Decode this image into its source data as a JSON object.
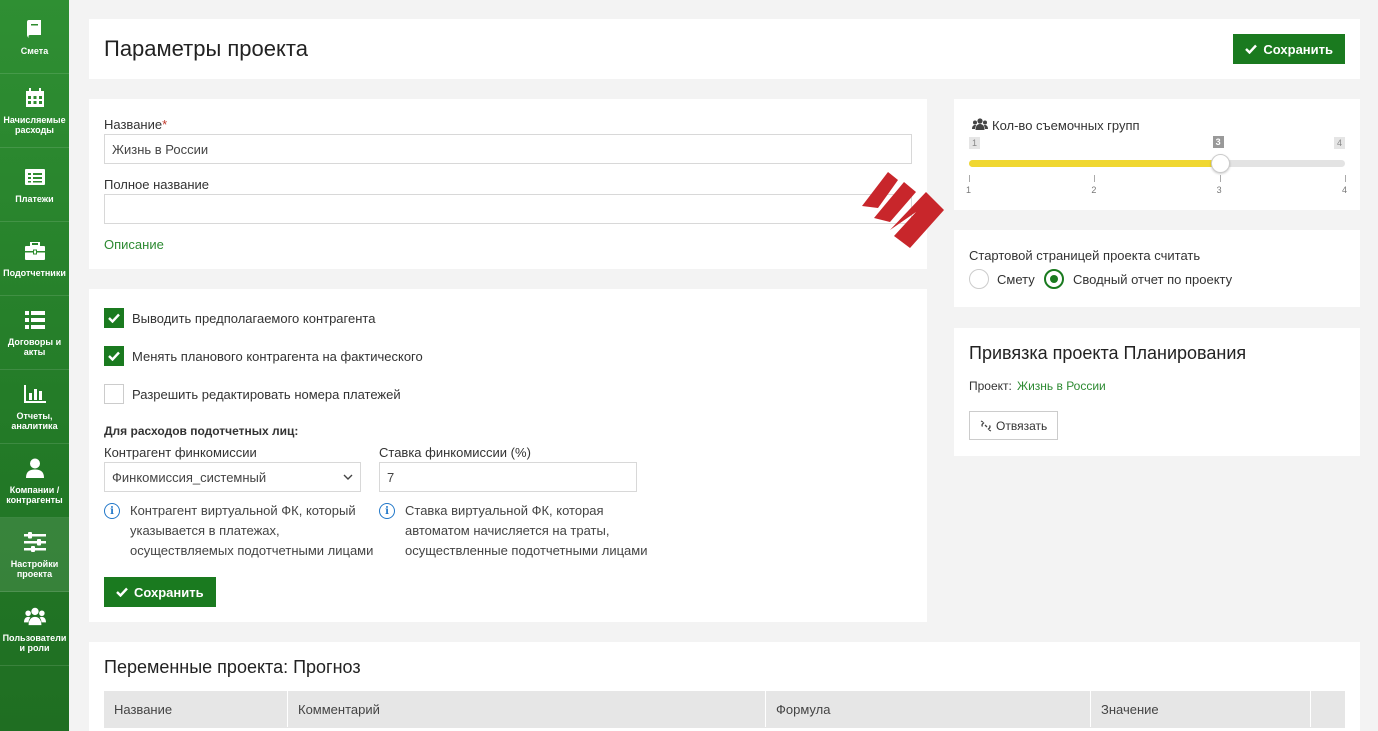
{
  "sidebar": {
    "items": [
      {
        "label": "Смета",
        "icon": "book-icon"
      },
      {
        "label": "Начисляемые расходы",
        "icon": "calendar-icon"
      },
      {
        "label": "Платежи",
        "icon": "list-icon"
      },
      {
        "label": "Подотчетники",
        "icon": "briefcase-icon"
      },
      {
        "label": "Договоры и акты",
        "icon": "contract-list-icon"
      },
      {
        "label": "Отчеты, аналитика",
        "icon": "bar-chart-icon"
      },
      {
        "label": "Компании / контрагенты",
        "icon": "user-icon"
      },
      {
        "label": "Настройки проекта",
        "icon": "sliders-icon"
      },
      {
        "label": "Пользователи и роли",
        "icon": "users-icon"
      }
    ]
  },
  "header": {
    "title": "Параметры проекта",
    "save_label": "Сохранить"
  },
  "general": {
    "name_label": "Название",
    "required_mark": "*",
    "name_value": "Жизнь в России",
    "full_name_label": "Полное название",
    "full_name_value": "",
    "description_link": "Описание"
  },
  "options": {
    "checkboxes": [
      {
        "label": "Выводить предполагаемого контрагента",
        "checked": true
      },
      {
        "label": "Менять планового контрагента на фактического",
        "checked": true
      },
      {
        "label": "Разрешить редактировать номера платежей",
        "checked": false
      }
    ],
    "section_title": "Для расходов подотчетных лиц:",
    "contractor_label": "Контрагент финкомиссии",
    "contractor_value": "Финкомиссия_системный",
    "rate_label": "Ставка финкомиссии (%)",
    "rate_value": "7",
    "contractor_hint": [
      "Контрагент виртуальной ФК, который",
      "указывается в платежах,",
      "осуществляемых подотчетными лицами"
    ],
    "rate_hint": [
      "Ставка виртуальной ФК, которая",
      "автоматом начисляется на траты,",
      "осуществленные подотчетными лицами"
    ],
    "save_label": "Сохранить"
  },
  "crews": {
    "label": "Кол-во съемочных групп",
    "min": 1,
    "max": 4,
    "value": 3,
    "min_label": "1",
    "max_label": "4",
    "value_label": "3",
    "ticks": [
      "1",
      "2",
      "3",
      "4"
    ],
    "fill_color": "#f0d731"
  },
  "start_page": {
    "label": "Стартовой страницей проекта считать",
    "options": [
      {
        "label": "Смету",
        "selected": false
      },
      {
        "label": "Сводный отчет по проекту",
        "selected": true
      }
    ]
  },
  "planning": {
    "title": "Привязка проекта Планирования",
    "project_label": "Проект:",
    "project_value": "Жизнь в России",
    "unlink_label": "Отвязать"
  },
  "variables": {
    "title": "Переменные проекта: Прогноз",
    "columns": [
      "Название",
      "Комментарий",
      "Формула",
      "Значение"
    ]
  },
  "colors": {
    "accent": "#1a7a1f",
    "sidebar": "#2e8b2e",
    "link": "#2d8a32",
    "arrow": "#c8262b"
  }
}
